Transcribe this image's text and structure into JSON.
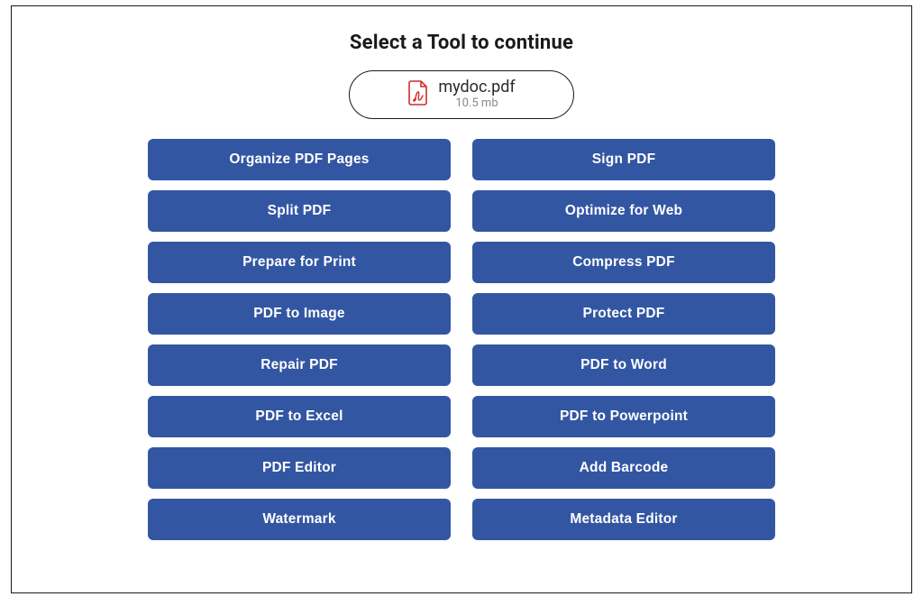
{
  "title": "Select a Tool to continue",
  "file": {
    "name": "mydoc.pdf",
    "size": "10.5 mb"
  },
  "tools": [
    {
      "label": "Organize PDF Pages"
    },
    {
      "label": "Sign PDF"
    },
    {
      "label": "Split PDF"
    },
    {
      "label": "Optimize for Web"
    },
    {
      "label": "Prepare for Print"
    },
    {
      "label": "Compress PDF"
    },
    {
      "label": "PDF to Image"
    },
    {
      "label": "Protect PDF"
    },
    {
      "label": "Repair PDF"
    },
    {
      "label": "PDF to Word"
    },
    {
      "label": "PDF to Excel"
    },
    {
      "label": "PDF to Powerpoint"
    },
    {
      "label": "PDF Editor"
    },
    {
      "label": "Add Barcode"
    },
    {
      "label": "Watermark"
    },
    {
      "label": "Metadata Editor"
    }
  ]
}
